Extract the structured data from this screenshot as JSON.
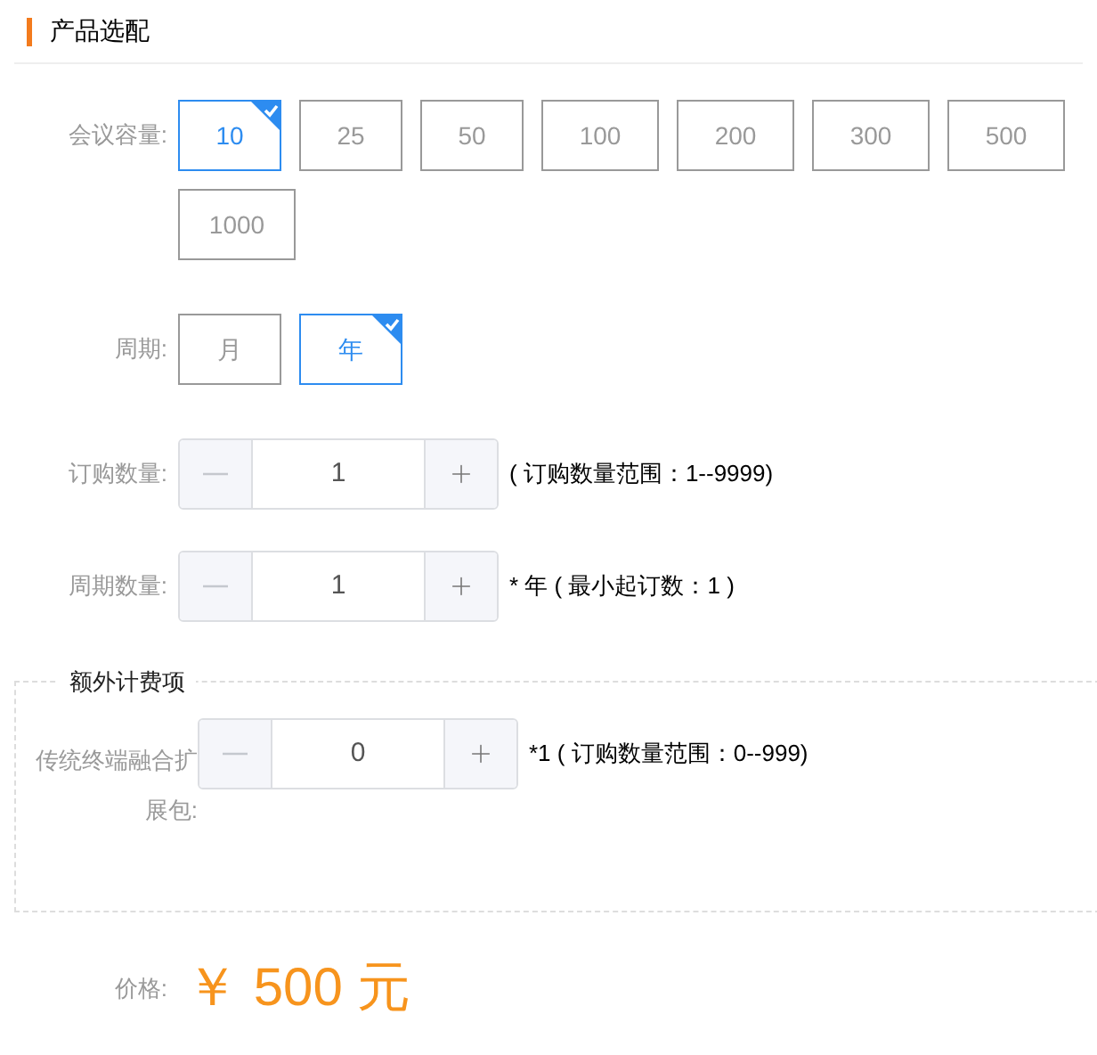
{
  "section_title": "产品选配",
  "capacity": {
    "label": "会议容量:",
    "options": [
      {
        "label": "10",
        "selected": true
      },
      {
        "label": "25",
        "selected": false
      },
      {
        "label": "50",
        "selected": false
      },
      {
        "label": "100",
        "selected": false
      },
      {
        "label": "200",
        "selected": false
      },
      {
        "label": "300",
        "selected": false
      },
      {
        "label": "500",
        "selected": false
      },
      {
        "label": "1000",
        "selected": false
      }
    ]
  },
  "period": {
    "label": "周期:",
    "options": [
      {
        "label": "月",
        "selected": false
      },
      {
        "label": "年",
        "selected": true
      }
    ]
  },
  "order_quantity": {
    "label": "订购数量:",
    "value": "1",
    "note": "( 订购数量范围：1--9999)"
  },
  "period_quantity": {
    "label": "周期数量:",
    "value": "1",
    "note": "* 年 ( 最小起订数：1 )"
  },
  "extra": {
    "title": "额外计费项",
    "items": [
      {
        "label": "传统终端融合扩展包:",
        "value": "0",
        "note": "*1 ( 订购数量范围：0--999)"
      }
    ]
  },
  "price": {
    "label": "价格:",
    "value": "￥ 500 元"
  }
}
